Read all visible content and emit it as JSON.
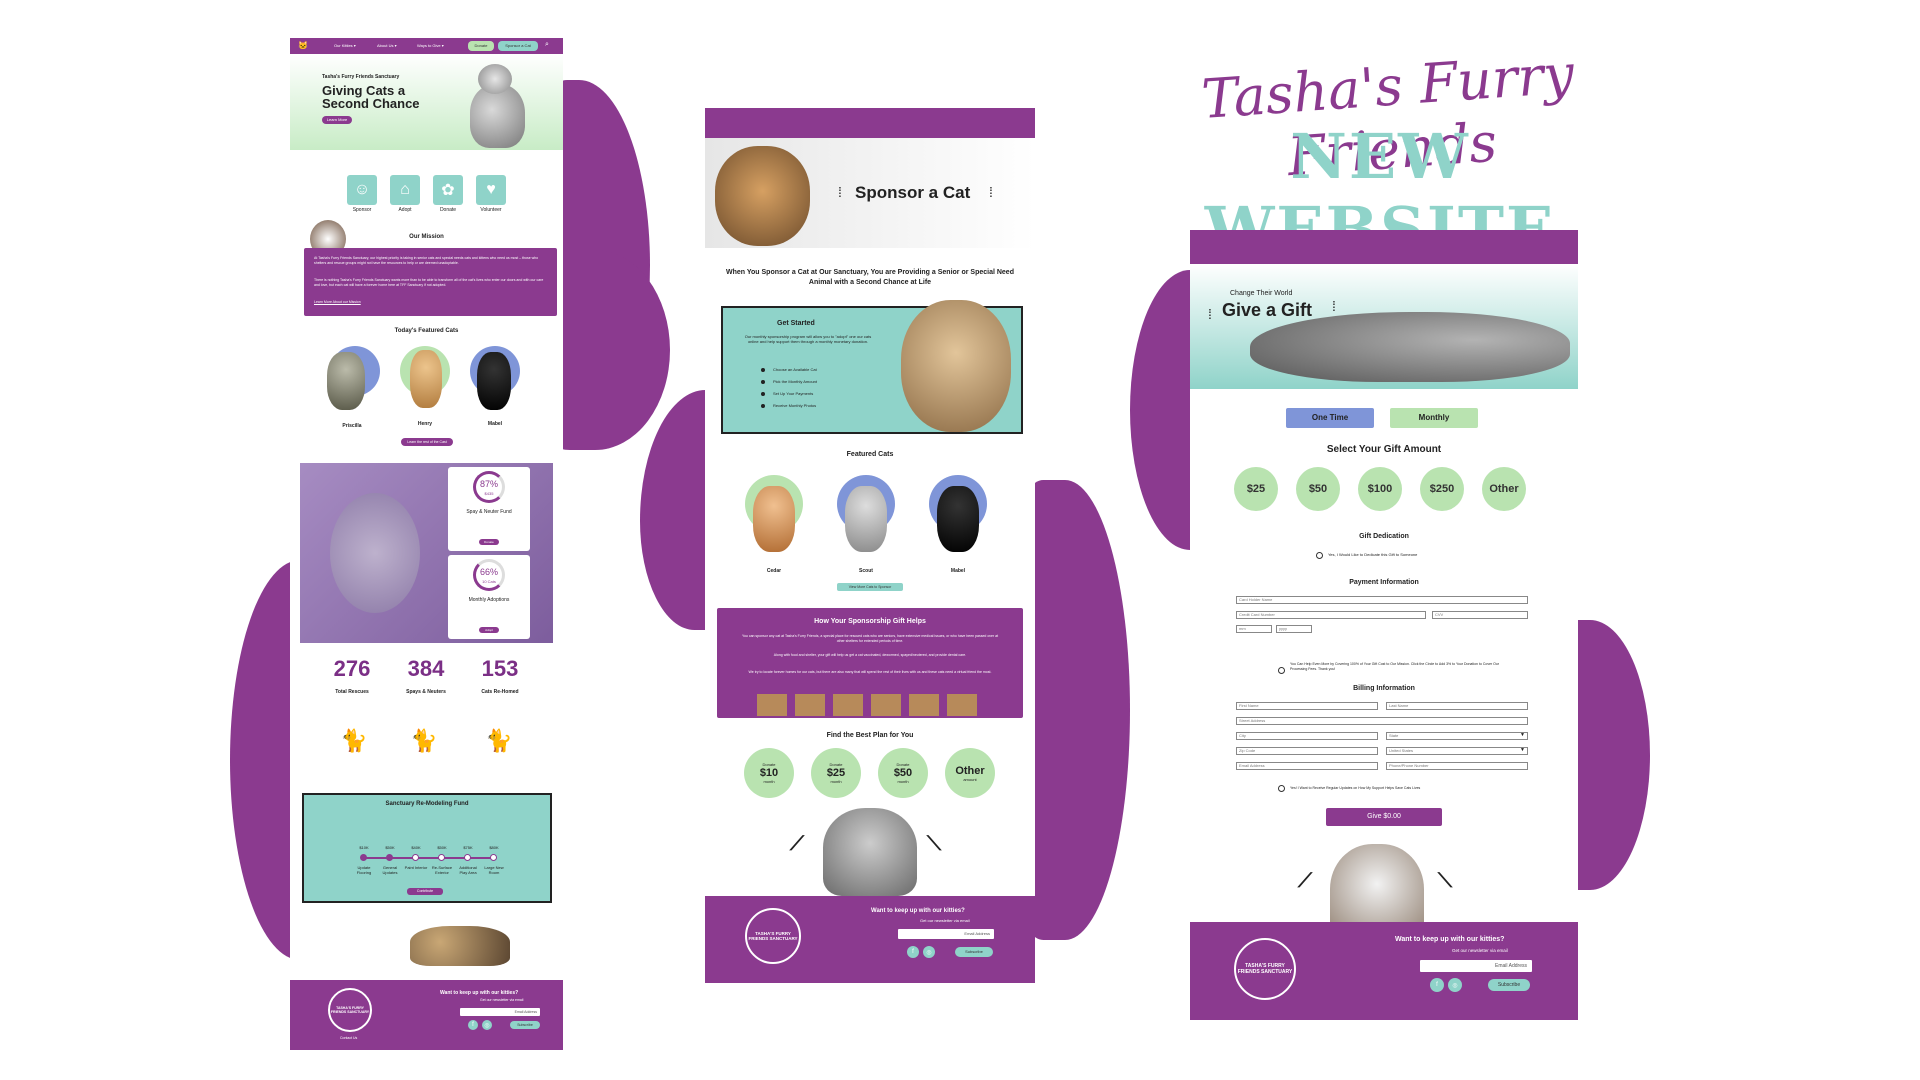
{
  "header": {
    "script_title": "Tasha's Furry Friends",
    "big_title": "NEW WEBSITE"
  },
  "colors": {
    "purple": "#8b3a8f",
    "teal": "#8fd3c9",
    "green": "#b9e3b0",
    "blue": "#7f95d8"
  },
  "home": {
    "nav": {
      "items": [
        "Our Kitties ▾",
        "About Us ▾",
        "Ways to Give ▾"
      ],
      "donate": "Donate",
      "sponsor": "Sponsor a Cat",
      "search_icon": "search-icon",
      "logo_icon": "cat-logo-icon"
    },
    "hero": {
      "kicker": "Tasha's Furry Friends Sanctuary",
      "title_line1": "Giving Cats a",
      "title_line2": "Second Chance",
      "button": "Learn More"
    },
    "quick_links": [
      {
        "label": "Sponsor",
        "icon": "cat-face-icon"
      },
      {
        "label": "Adopt",
        "icon": "house-icon"
      },
      {
        "label": "Donate",
        "icon": "paw-icon"
      },
      {
        "label": "Volunteer",
        "icon": "handshake-icon"
      }
    ],
    "mission": {
      "title": "Our Mission",
      "p1": "At Tasha's Furry Friends Sanctuary, our highest priority is taking in senior cats and special needs cats and kittens who need us most – those who shelters and rescue groups might not have the resources to help or are deemed unadoptable.",
      "p2": "There is nothing Tasha's Furry Friends Sanctuary wants more than to be able to transform all of the cat's lives who enter our doors and with our care and love, but each cat will have a forever home here at TFF Sanctuary if not adopted.",
      "link": "Learn More About our Mission"
    },
    "featured": {
      "title": "Today's Featured Cats",
      "cats": [
        "Priscilla",
        "Henry",
        "Mabel"
      ],
      "button": "Learn the rest of the Cast"
    },
    "funds": [
      {
        "percent": "87%",
        "sub": "$435",
        "title": "Spay & Neuter Fund",
        "button": "Donate",
        "value": 0.87
      },
      {
        "percent": "66%",
        "sub": "10 Cats",
        "title": "Monthly Adoptions",
        "button": "Adopt",
        "value": 0.66
      }
    ],
    "stats": [
      {
        "number": "276",
        "label": "Total Rescues"
      },
      {
        "number": "384",
        "label": "Spays & Neuters"
      },
      {
        "number": "153",
        "label": "Cats Re-Homed"
      }
    ],
    "remodel": {
      "title": "Sanctuary Re-Modeling Fund",
      "amounts": [
        "$10K",
        "$50K",
        "$40K",
        "$50K",
        "$75K",
        "$80K"
      ],
      "steps": [
        "Update Flooring",
        "General Updates",
        "Paint Interior",
        "Re-Surface Exterior",
        "Additional Play Area",
        "Large New Room"
      ],
      "button": "Contribute"
    },
    "footer": {
      "logo": "TASHA'S FURRY FRIENDS SANCTUARY",
      "heading": "Want to keep up with our kitties?",
      "sub": "Get our newsletter via email",
      "email_placeholder": "Email Address",
      "subscribe": "Subscribe",
      "contact": "Contact Us"
    }
  },
  "sponsor": {
    "hero_title": "Sponsor a Cat",
    "intro": "When You Sponsor a Cat at Our Sanctuary, You are Providing a Senior or Special Need Animal with a Second Chance at Life",
    "get_started": {
      "title": "Get Started",
      "desc": "Our monthly sponsorship program will allow you to \"adopt\" one our cats online and help support them through a monthly monetary donation.",
      "steps": [
        "Choose an Available Cat",
        "Pick the Monthly Amount",
        "Set Up Your Payments",
        "Receive Monthly Photos"
      ]
    },
    "featured": {
      "title": "Featured Cats",
      "cats": [
        "Cedar",
        "Scout",
        "Mabel"
      ],
      "button": "View More Cats to Sponsor"
    },
    "helps": {
      "title": "How Your Sponsorship Gift Helps",
      "p1": "You can sponsor any cat at Tasha's Furry Friends, a special place for rescued cats who are seniors, have extensive medical issues, or who have been passed over at other shelters for extended periods of time.",
      "p2": "Along with food and shelter, your gift will help us get a cat vaccinated, dewormed, spayed/neutered, and provide dental care.",
      "p3": "We try to locate forever homes for our cats, but there are also many that will spend the rest of their lives with us and these cats need a virtual friend the most."
    },
    "plans": {
      "title": "Find the Best Plan for You",
      "options": [
        {
          "small": "Donate",
          "amount": "$10",
          "per": "month"
        },
        {
          "small": "Donate",
          "amount": "$25",
          "per": "month"
        },
        {
          "small": "Donate",
          "amount": "$50",
          "per": "month"
        },
        {
          "small": "",
          "amount": "Other",
          "per": "amount"
        }
      ]
    },
    "footer": {
      "logo": "TASHA'S FURRY FRIENDS SANCTUARY",
      "heading": "Want to keep up with our kitties?",
      "sub": "Get our newsletter via email",
      "email_placeholder": "Email Address",
      "subscribe": "Subscribe"
    }
  },
  "donate": {
    "hero_kicker": "Change Their World",
    "hero_title": "Give a Gift",
    "tabs": [
      "One Time",
      "Monthly"
    ],
    "select_title": "Select Your Gift Amount",
    "amounts": [
      "$25",
      "$50",
      "$100",
      "$250",
      "Other"
    ],
    "dedication_title": "Gift Dedication",
    "dedication_check": "Yes, I Would Like to Dedicate this Gift to Someone",
    "payment_title": "Payment Information",
    "payment_fields": [
      "Card Holder Name",
      "Credit Card Number",
      "CVV",
      "mm",
      "yyyy"
    ],
    "cover_fee": "You Can Help Even More by Covering 100% of Your Gift Cost to Our Mission. Click the Circle to Add 3% to Your Donation to Cover Our Processing Fees. Thank you!",
    "billing_title": "Billing Information",
    "billing_fields": [
      "First Name",
      "Last Name",
      "Street Address",
      "City",
      "State",
      "Zip Code",
      "United States",
      "Email Address",
      "Phone/Phone Number"
    ],
    "updates_check": "Yes! I Want to Receive Regular Updates on How My Support Helps Save Cats Lives",
    "give_button": "Give $0.00",
    "footer": {
      "logo": "TASHA'S FURRY FRIENDS SANCTUARY",
      "heading": "Want to keep up with our kitties?",
      "sub": "Get our newsletter via email",
      "email_placeholder": "Email Address",
      "subscribe": "Subscribe"
    }
  }
}
